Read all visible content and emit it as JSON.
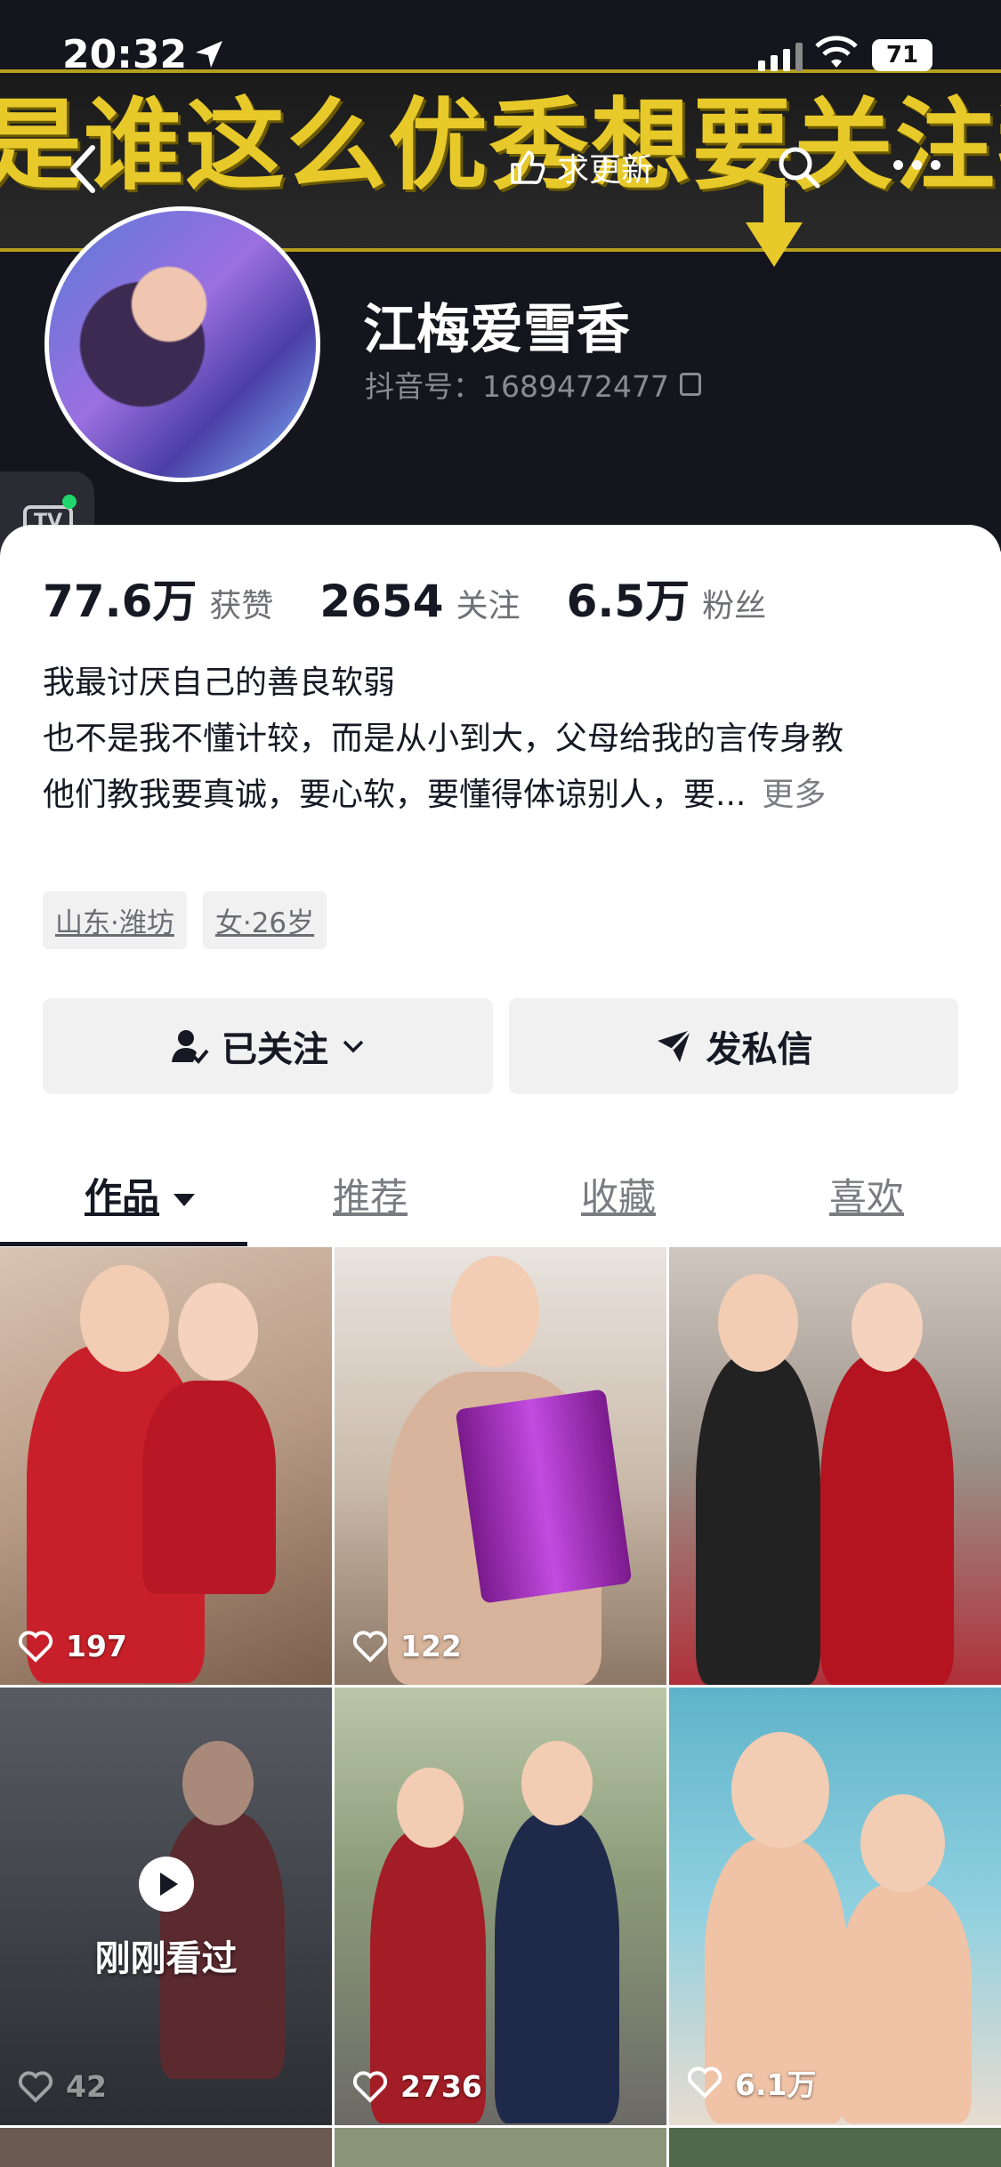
{
  "status_bar": {
    "time": "20:32",
    "battery": "71"
  },
  "banner": {
    "overlay_text": "是谁这么优秀想要关注我"
  },
  "nav": {
    "update_label": "求更新"
  },
  "profile": {
    "name": "江梅爱雪香",
    "douyin_id": "抖音号：1689472477"
  },
  "tv_badge": "TV",
  "stats": [
    {
      "value": "77.6万",
      "label": "获赞"
    },
    {
      "value": "2654",
      "label": "关注"
    },
    {
      "value": "6.5万",
      "label": "粉丝"
    }
  ],
  "bio": {
    "line1": "我最讨厌自己的善良软弱",
    "line2": "也不是我不懂计较，而是从小到大，父母给我的言传身教",
    "line3": "他们教我要真诚，要心软，要懂得体谅别人，要...",
    "more": "更多"
  },
  "tags": [
    "山东·潍坊",
    "女·26岁"
  ],
  "buttons": {
    "follow": "已关注",
    "message": "发私信"
  },
  "tabs": [
    "作品",
    "推荐",
    "收藏",
    "喜欢"
  ],
  "videos": [
    {
      "likes": "197"
    },
    {
      "likes": "122"
    },
    {
      "likes": ""
    },
    {
      "likes": "42",
      "badge": "刚刚看过"
    },
    {
      "likes": "2736"
    },
    {
      "likes": "6.1万"
    }
  ]
}
